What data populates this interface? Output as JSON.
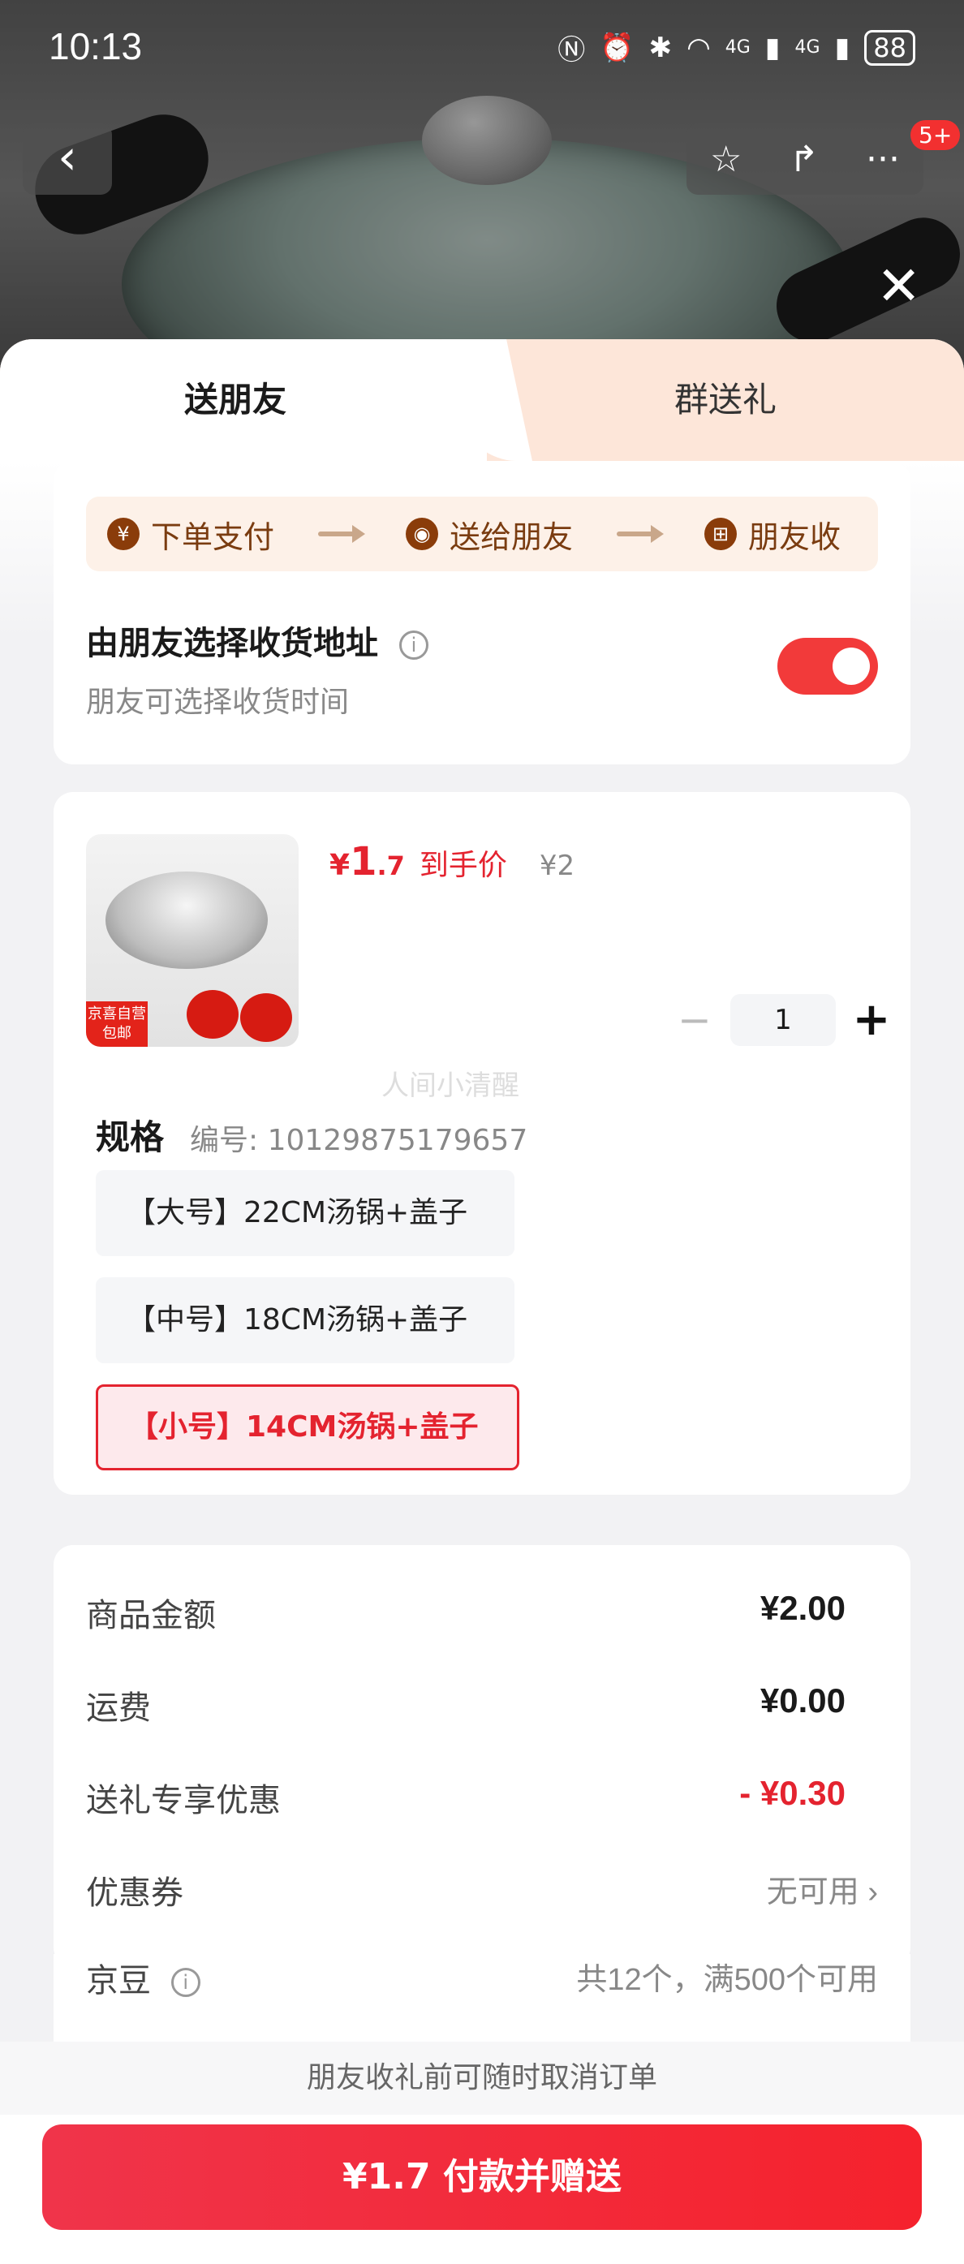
{
  "status_bar": {
    "time": "10:13",
    "battery": "88",
    "net1": "4G",
    "net2": "4G"
  },
  "nav": {
    "more_badge": "5+"
  },
  "tabs": [
    {
      "label": "送朋友",
      "active": true
    },
    {
      "label": "群送礼",
      "active": false
    }
  ],
  "steps": [
    {
      "icon": "¥",
      "label": "下单支付"
    },
    {
      "icon": "◉",
      "label": "送给朋友"
    },
    {
      "icon": "⊞",
      "label": "朋友收"
    }
  ],
  "address": {
    "title": "由朋友选择收货地址",
    "subtitle": "朋友可选择收货时间",
    "toggle_on": true
  },
  "product": {
    "tag": "京喜自营 包邮",
    "price_currency": "¥",
    "price_int": "1",
    "price_dec": ".7",
    "price_label": "到手价",
    "original_price": "¥2",
    "quantity": "1"
  },
  "spec": {
    "title": "规格",
    "code": "编号: 10129875179657",
    "options": [
      {
        "label": "【大号】22CM汤锅+盖子",
        "selected": false
      },
      {
        "label": "【中号】18CM汤锅+盖子",
        "selected": false
      },
      {
        "label": "【小号】14CM汤锅+盖子",
        "selected": true
      }
    ]
  },
  "summary": [
    {
      "label": "商品金额",
      "value": "¥2.00"
    },
    {
      "label": "运费",
      "value": "¥0.00"
    },
    {
      "label": "送礼专享优惠",
      "value": "- ¥0.30"
    },
    {
      "label": "优惠券",
      "value": "无可用 ›"
    },
    {
      "label": "京豆",
      "value": "共12个，满500个可用"
    }
  ],
  "watermark": "人间小清醒",
  "footer": {
    "notice": "朋友收礼前可随时取消订单",
    "pay_label": "¥1.7 付款并赠送"
  },
  "colors": {
    "accent": "#e4232f",
    "toggle": "#f23a3a",
    "tab_bg": "#fde6d9"
  }
}
